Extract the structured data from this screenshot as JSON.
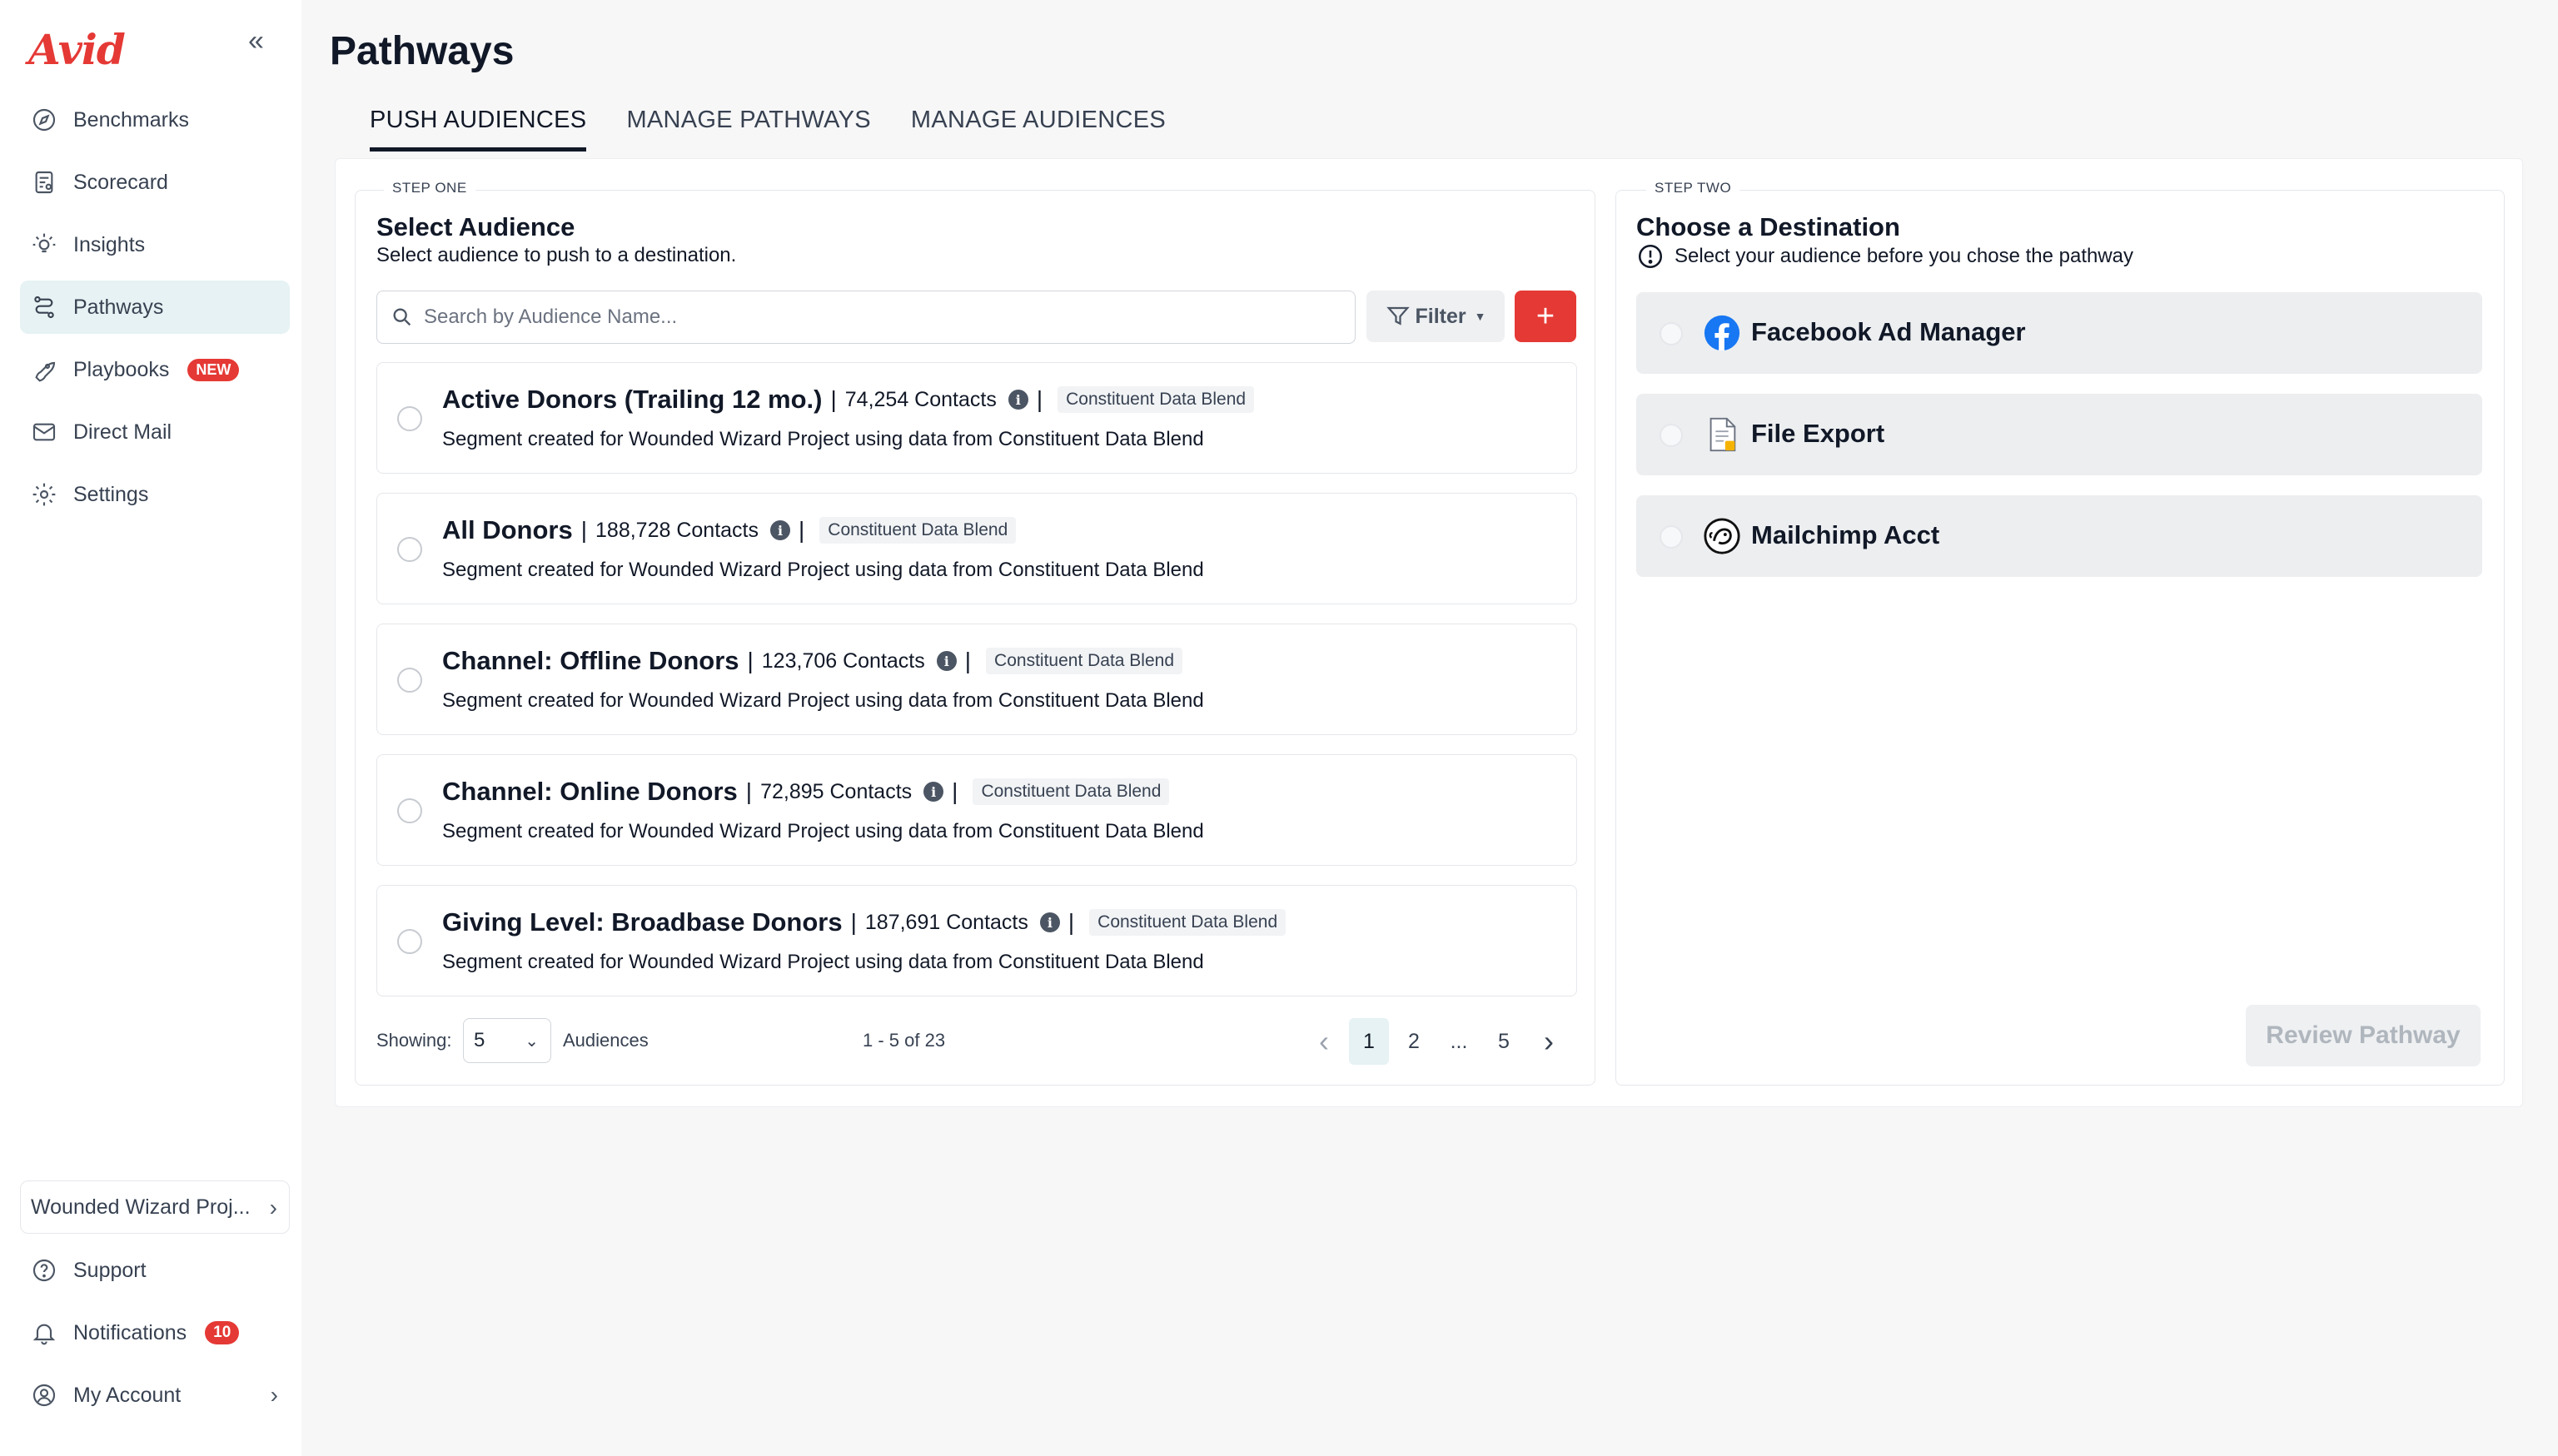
{
  "brand": {
    "logo_text": "Avid",
    "accent": "#e53935"
  },
  "sidebar": {
    "collapse_icon": "double-chevron-left-icon",
    "items": [
      {
        "label": "Benchmarks",
        "icon": "compass-icon"
      },
      {
        "label": "Scorecard",
        "icon": "scorecard-icon"
      },
      {
        "label": "Insights",
        "icon": "lightbulb-icon"
      },
      {
        "label": "Pathways",
        "icon": "route-icon",
        "active": true
      },
      {
        "label": "Playbooks",
        "icon": "rocket-icon",
        "badge": "NEW"
      },
      {
        "label": "Direct Mail",
        "icon": "mail-icon"
      },
      {
        "label": "Settings",
        "icon": "gear-icon"
      }
    ],
    "org_name": "Wounded Wizard Proj...",
    "bottom": [
      {
        "label": "Support",
        "icon": "help-circle-icon"
      },
      {
        "label": "Notifications",
        "icon": "bell-icon",
        "badge": "10"
      },
      {
        "label": "My Account",
        "icon": "user-circle-icon"
      }
    ]
  },
  "page": {
    "title": "Pathways",
    "tabs": [
      {
        "label": "PUSH AUDIENCES",
        "active": true
      },
      {
        "label": "MANAGE PATHWAYS"
      },
      {
        "label": "MANAGE AUDIENCES"
      }
    ]
  },
  "step_one": {
    "tag": "STEP ONE",
    "title": "Select Audience",
    "subtitle": "Select audience to push to a destination.",
    "search_placeholder": "Search by Audience Name...",
    "filter_label": "Filter",
    "add_label": "+",
    "audiences": [
      {
        "name": "Active Donors (Trailing 12 mo.)",
        "contacts": "74,254 Contacts",
        "source": "Constituent Data Blend",
        "description": "Segment created for Wounded Wizard Project using data from Constituent Data Blend"
      },
      {
        "name": "All Donors",
        "contacts": "188,728 Contacts",
        "source": "Constituent Data Blend",
        "description": "Segment created for Wounded Wizard Project using data from Constituent Data Blend"
      },
      {
        "name": "Channel: Offline Donors",
        "contacts": "123,706 Contacts",
        "source": "Constituent Data Blend",
        "description": "Segment created for Wounded Wizard Project using data from Constituent Data Blend"
      },
      {
        "name": "Channel: Online Donors",
        "contacts": "72,895 Contacts",
        "source": "Constituent Data Blend",
        "description": "Segment created for Wounded Wizard Project using data from Constituent Data Blend"
      },
      {
        "name": "Giving Level: Broadbase Donors",
        "contacts": "187,691 Contacts",
        "source": "Constituent Data Blend",
        "description": "Segment created for Wounded Wizard Project using data from Constituent Data Blend"
      }
    ],
    "pagination": {
      "showing_label": "Showing:",
      "page_size": "5",
      "audiences_label": "Audiences",
      "range": "1 - 5 of 23",
      "pages": [
        "1",
        "2",
        "...",
        "5"
      ],
      "current_page": "1"
    }
  },
  "step_two": {
    "tag": "STEP TWO",
    "title": "Choose a Destination",
    "subtitle": "Select your audience before you chose the pathway",
    "destinations": [
      {
        "label": "Facebook Ad Manager",
        "icon": "facebook-icon",
        "color": "#1877f2"
      },
      {
        "label": "File Export",
        "icon": "file-export-icon"
      },
      {
        "label": "Mailchimp Acct",
        "icon": "mailchimp-icon"
      }
    ],
    "review_label": "Review Pathway"
  }
}
